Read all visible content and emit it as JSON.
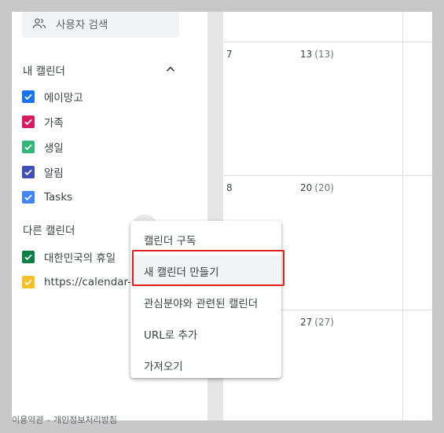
{
  "sidebar": {
    "search": {
      "label": "사용자 검색",
      "icon": "people-icon"
    },
    "my_calendars": {
      "title": "내 캘린더",
      "items": [
        {
          "label": "에이망고",
          "color": "#1a73e8"
        },
        {
          "label": "가족",
          "color": "#d81b60"
        },
        {
          "label": "생일",
          "color": "#33b679"
        },
        {
          "label": "알림",
          "color": "#3f51b5"
        },
        {
          "label": "Tasks",
          "color": "#4285f4"
        }
      ]
    },
    "other_calendars": {
      "title": "다른 캘린더",
      "items": [
        {
          "label": "대한민국의 휴일",
          "color": "#0b8043"
        },
        {
          "label": "https://calendar-ic",
          "color": "#f6bf26"
        }
      ]
    },
    "footer": "이용약관 – 개인정보처리방침"
  },
  "grid": {
    "rows": [
      {
        "left": "7",
        "right": "13",
        "right_sub": "(13)"
      },
      {
        "left": "8",
        "right": "20",
        "right_sub": "(20)"
      },
      {
        "left": "",
        "right": "27",
        "right_sub": "(27)"
      }
    ]
  },
  "menu": {
    "items": [
      {
        "label": "캘린더 구독"
      },
      {
        "label": "새 캘린더 만들기",
        "highlighted": true
      },
      {
        "label": "관심분야와 관련된 캘린더"
      },
      {
        "label": "URL로 추가"
      },
      {
        "label": "가져오기"
      }
    ]
  },
  "colors": {
    "highlight_border": "#e0201b"
  }
}
